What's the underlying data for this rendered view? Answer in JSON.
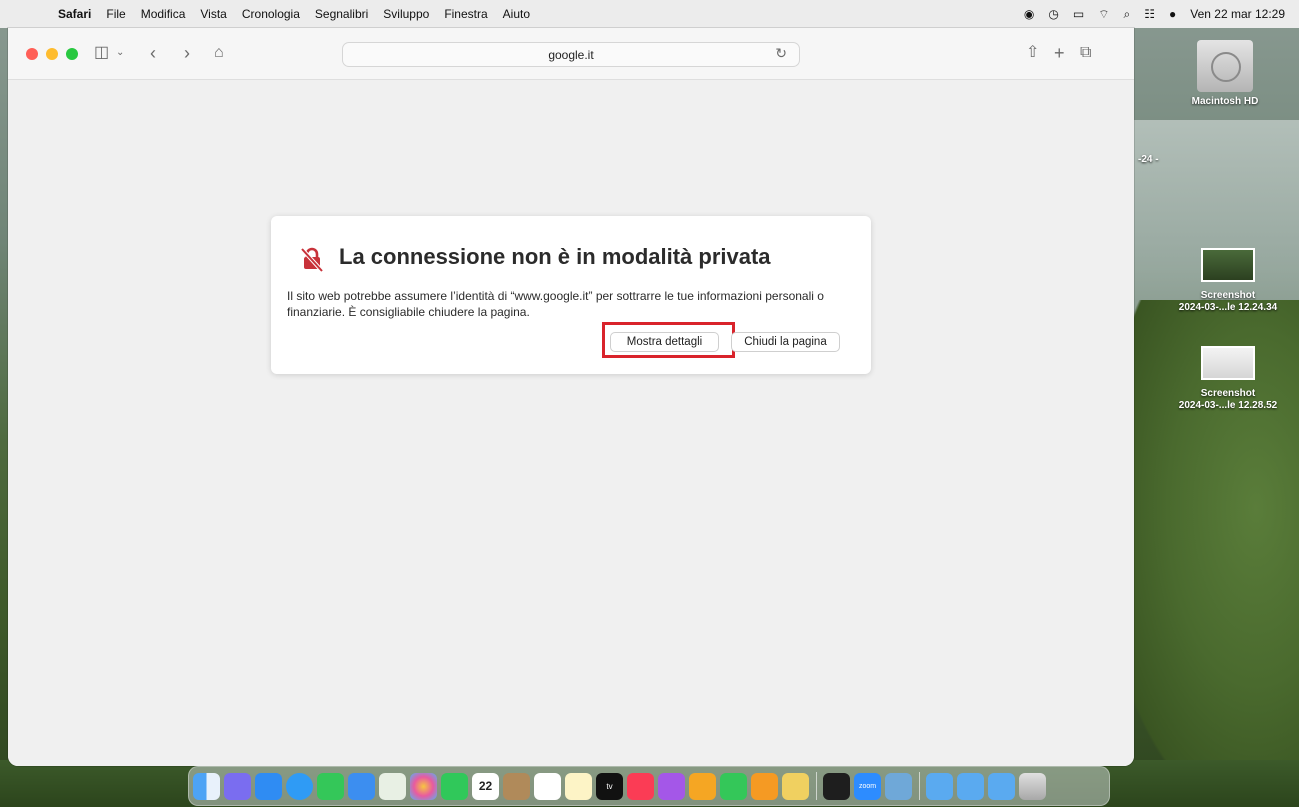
{
  "menubar": {
    "app_name": "Safari",
    "items": [
      "File",
      "Modifica",
      "Vista",
      "Cronologia",
      "Segnalibri",
      "Sviluppo",
      "Finestra",
      "Aiuto"
    ],
    "clock": "Ven 22 mar  12:29"
  },
  "browser": {
    "url": "google.it"
  },
  "dialog": {
    "title": "La connessione non è in modalità privata",
    "message": "Il sito web potrebbe assumere l’identità di “www.google.it” per sottrarre le tue informazioni personali o finanziarie. È consigliabile chiudere la pagina.",
    "show_details_label": "Mostra dettagli",
    "close_page_label": "Chiudi la pagina"
  },
  "desktop": {
    "hd_label": "Macintosh HD",
    "peek_label": "-24 -",
    "screenshot1_line1": "Screenshot",
    "screenshot1_line2": "2024-03-...le 12.24.34",
    "screenshot2_line1": "Screenshot",
    "screenshot2_line2": "2024-03-...le 12.28.52"
  },
  "dock": {
    "calendar_day": "22",
    "tv_label": "tv",
    "zoom_label": "zoom"
  },
  "colors": {
    "highlight": "#d9232b",
    "lock_icon": "#c8323a"
  }
}
